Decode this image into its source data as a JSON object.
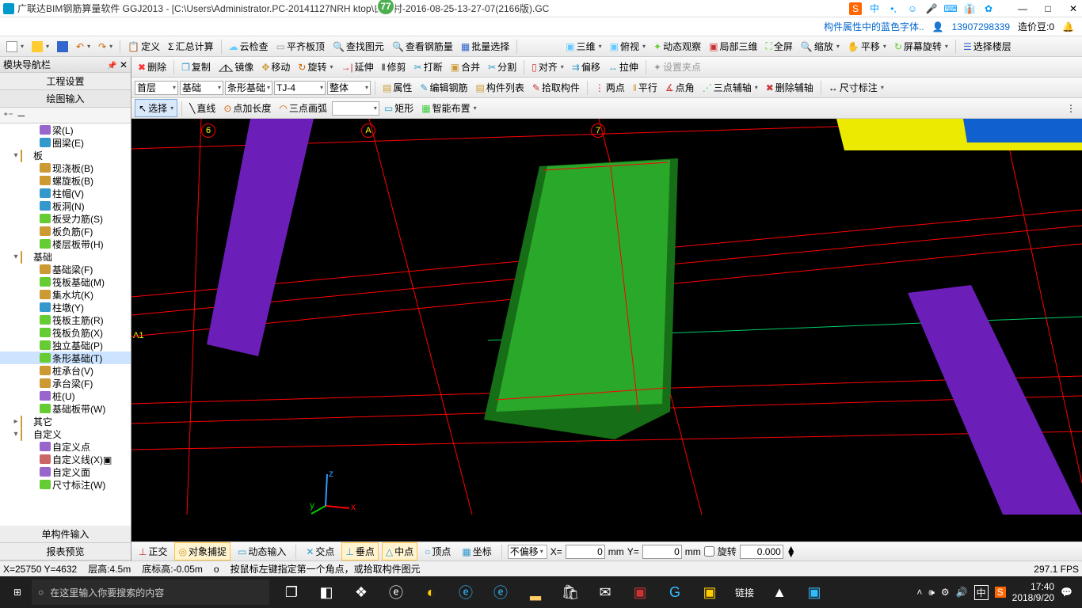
{
  "title": "广联达BIM钢筋算量软件 GGJ2013 - [C:\\Users\\Administrator.PC-20141127NRH       ktop\\白龙村-2016-08-25-13-27-07(2166版).GC",
  "badge77": "77",
  "ime_icons": [
    "S",
    "中",
    "•,",
    "☺",
    "🎤",
    "⌨",
    "👔",
    "✿"
  ],
  "win": {
    "min": "—",
    "max": "□",
    "close": "✕"
  },
  "topbar2": {
    "bluelink": "构件属性中的蓝色字体..",
    "user": "13907298339",
    "credits_label": "造价豆:0"
  },
  "toolbar1": [
    "定义",
    "汇总计算",
    "云检查",
    "平齐板顶",
    "查找图元",
    "查看钢筋量",
    "批量选择",
    "三维",
    "俯视",
    "动态观察",
    "局部三维",
    "全屏",
    "缩放",
    "平移",
    "屏幕旋转",
    "选择楼层"
  ],
  "toolbar2": [
    "删除",
    "复制",
    "镜像",
    "移动",
    "旋转",
    "延伸",
    "修剪",
    "打断",
    "合并",
    "分割",
    "对齐",
    "偏移",
    "拉伸",
    "设置夹点"
  ],
  "combos": {
    "floor": "首层",
    "cat": "基础",
    "subcat": "条形基础",
    "member": "TJ-4",
    "mode": "整体"
  },
  "toolbar3": [
    "属性",
    "编辑钢筋",
    "构件列表",
    "拾取构件",
    "两点",
    "平行",
    "点角",
    "三点辅轴",
    "删除辅轴",
    "尺寸标注"
  ],
  "toolbar4": {
    "select": "选择",
    "line": "直线",
    "ptlen": "点加长度",
    "arc3": "三点画弧",
    "rect": "矩形",
    "smart": "智能布置"
  },
  "sidebar": {
    "header": "模块导航栏",
    "tab1": "工程设置",
    "tab2": "绘图输入",
    "bottom1": "单构件输入",
    "bottom2": "报表预览"
  },
  "tree": [
    {
      "indent": 3,
      "icon": "beam",
      "label": "梁(L)"
    },
    {
      "indent": 3,
      "icon": "ring",
      "label": "圈梁(E)"
    },
    {
      "indent": 1,
      "toggle": "▾",
      "icon": "folder",
      "label": "板"
    },
    {
      "indent": 3,
      "icon": "slab",
      "label": "现浇板(B)"
    },
    {
      "indent": 3,
      "icon": "spiral",
      "label": "螺旋板(B)"
    },
    {
      "indent": 3,
      "icon": "cap",
      "label": "柱帽(V)"
    },
    {
      "indent": 3,
      "icon": "hole",
      "label": "板洞(N)"
    },
    {
      "indent": 3,
      "icon": "rebar",
      "label": "板受力筋(S)"
    },
    {
      "indent": 3,
      "icon": "neg",
      "label": "板负筋(F)"
    },
    {
      "indent": 3,
      "icon": "strip",
      "label": "楼层板带(H)"
    },
    {
      "indent": 1,
      "toggle": "▾",
      "icon": "folder",
      "label": "基础"
    },
    {
      "indent": 3,
      "icon": "fbeam",
      "label": "基础梁(F)"
    },
    {
      "indent": 3,
      "icon": "raft",
      "label": "筏板基础(M)"
    },
    {
      "indent": 3,
      "icon": "sump",
      "label": "集水坑(K)"
    },
    {
      "indent": 3,
      "icon": "pier",
      "label": "柱墩(Y)"
    },
    {
      "indent": 3,
      "icon": "rmain",
      "label": "筏板主筋(R)"
    },
    {
      "indent": 3,
      "icon": "rneg",
      "label": "筏板负筋(X)"
    },
    {
      "indent": 3,
      "icon": "iso",
      "label": "独立基础(P)"
    },
    {
      "indent": 3,
      "icon": "strip2",
      "label": "条形基础(T)",
      "selected": true
    },
    {
      "indent": 3,
      "icon": "pile",
      "label": "桩承台(V)"
    },
    {
      "indent": 3,
      "icon": "pbeam",
      "label": "承台梁(F)"
    },
    {
      "indent": 3,
      "icon": "pile2",
      "label": "桩(U)"
    },
    {
      "indent": 3,
      "icon": "bstrip",
      "label": "基础板带(W)"
    },
    {
      "indent": 1,
      "toggle": "▸",
      "icon": "folder",
      "label": "其它"
    },
    {
      "indent": 1,
      "toggle": "▾",
      "icon": "folder",
      "label": "自定义"
    },
    {
      "indent": 3,
      "icon": "pt",
      "label": "自定义点"
    },
    {
      "indent": 3,
      "icon": "ln",
      "label": "自定义线(X)▣"
    },
    {
      "indent": 3,
      "icon": "face",
      "label": "自定义面"
    },
    {
      "indent": 3,
      "icon": "dim",
      "label": "尺寸标注(W)"
    }
  ],
  "axis_labels": {
    "l6": "6",
    "la": "A",
    "l7": "7",
    "la1": "A1"
  },
  "snapbar": {
    "ortho": "正交",
    "osnap": "对象捕捉",
    "dyn": "动态输入",
    "cross": "交点",
    "perp": "垂点",
    "mid": "中点",
    "top": "顶点",
    "coord": "坐标",
    "offset_mode": "不偏移",
    "x_label": "X=",
    "x_val": "0",
    "mm": "mm",
    "y_label": "Y=",
    "y_val": "0",
    "rotate": "旋转",
    "rot_val": "0.000"
  },
  "status": {
    "coord": "X=25750 Y=4632",
    "floor": "层高:4.5m",
    "bottom": "底标高:-0.05m",
    "o": "o",
    "hint": "按鼠标左键指定第一个角点，或拾取构件图元",
    "fps": "297.1 FPS"
  },
  "taskbar": {
    "search_placeholder": "在这里输入你要搜索的内容",
    "linked": "链接",
    "time": "17:40",
    "date": "2018/9/20"
  }
}
